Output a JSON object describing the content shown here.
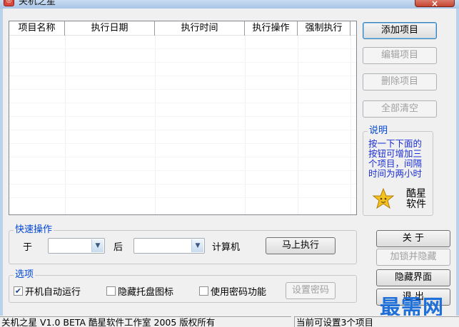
{
  "window": {
    "title": "关机之星",
    "close_label": "×"
  },
  "list": {
    "columns": [
      "项目名称",
      "执行日期",
      "执行时间",
      "执行操作",
      "强制执行"
    ]
  },
  "side_buttons": {
    "add": "添加项目",
    "edit": "编辑项目",
    "delete": "删除项目",
    "clear_all": "全部清空"
  },
  "description": {
    "title": "说明",
    "text": "按一下下面的按钮可增加三个项目，间隔时间为两小时",
    "brand_line1": "酷星",
    "brand_line2": "软件",
    "icon": "star-icon"
  },
  "quick_ops": {
    "title": "快速操作",
    "label_at": "于",
    "label_after": "后",
    "label_computer": "计算机",
    "time_value": "",
    "action_value": "",
    "execute_button": "马上执行"
  },
  "options": {
    "title": "选项",
    "autorun": {
      "label": "开机自动运行",
      "checked": true
    },
    "hide_tray": {
      "label": "隐藏托盘图标",
      "checked": false
    },
    "use_password": {
      "label": "使用密码功能",
      "checked": false
    },
    "set_password_button": "设置密码"
  },
  "right_buttons": {
    "about": "关 于",
    "lock_hide": "加锁并隐藏",
    "hide_ui": "隐藏界面",
    "exit": "退 出"
  },
  "status": {
    "left": "关机之星 V1.0 BETA 酷星软件工作室 2005 版权所有",
    "right": "当前可设置3个项目"
  },
  "watermark": "最需网"
}
